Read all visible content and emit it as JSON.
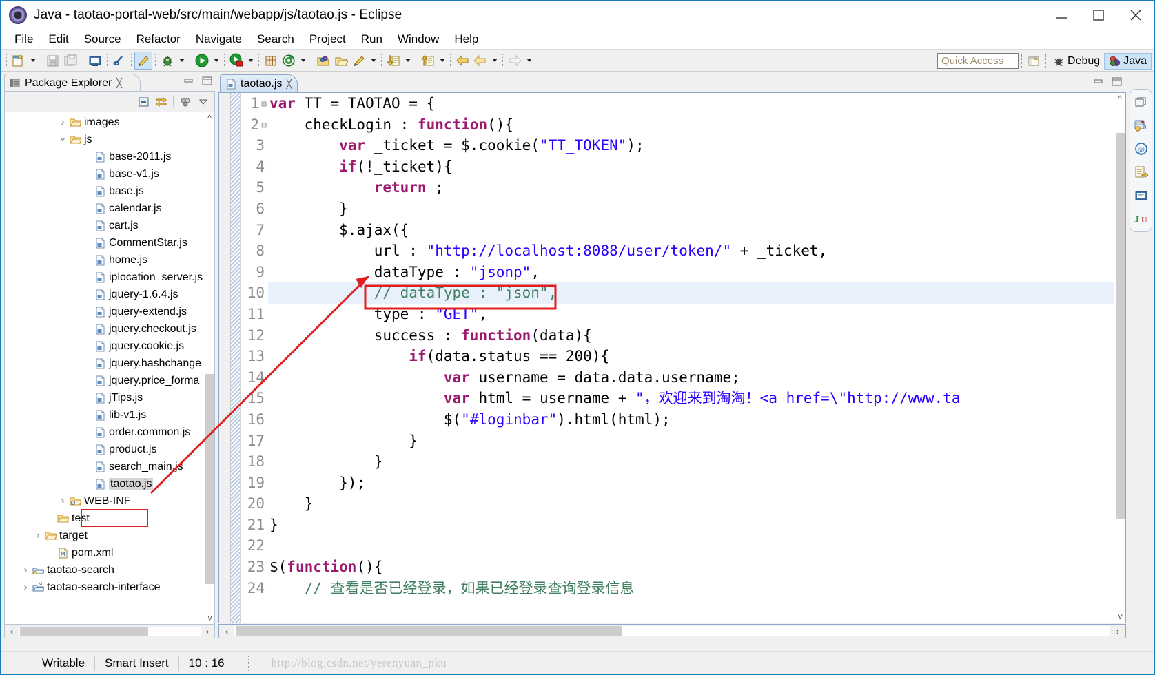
{
  "window": {
    "title": "Java - taotao-portal-web/src/main/webapp/js/taotao.js - Eclipse",
    "minimize": "─",
    "maximize": "□",
    "close": "✕"
  },
  "menubar": {
    "items": [
      "File",
      "Edit",
      "Source",
      "Refactor",
      "Navigate",
      "Search",
      "Project",
      "Run",
      "Window",
      "Help"
    ]
  },
  "toolbar": {
    "quick_access_placeholder": "Quick Access",
    "perspectives": [
      {
        "label": "Debug",
        "active": false
      },
      {
        "label": "Java",
        "active": true
      }
    ]
  },
  "package_explorer": {
    "tab_label": "Package Explorer",
    "tree": [
      {
        "label": "images",
        "indent": 4,
        "arrow": "closed",
        "icon": "folder",
        "sel": false
      },
      {
        "label": "js",
        "indent": 4,
        "arrow": "open",
        "icon": "folder",
        "sel": false
      },
      {
        "label": "base-2011.js",
        "indent": 6,
        "arrow": "none",
        "icon": "js-file",
        "sel": false
      },
      {
        "label": "base-v1.js",
        "indent": 6,
        "arrow": "none",
        "icon": "js-file",
        "sel": false
      },
      {
        "label": "base.js",
        "indent": 6,
        "arrow": "none",
        "icon": "js-file",
        "sel": false
      },
      {
        "label": "calendar.js",
        "indent": 6,
        "arrow": "none",
        "icon": "js-file",
        "sel": false
      },
      {
        "label": "cart.js",
        "indent": 6,
        "arrow": "none",
        "icon": "js-file",
        "sel": false
      },
      {
        "label": "CommentStar.js",
        "indent": 6,
        "arrow": "none",
        "icon": "js-file",
        "sel": false
      },
      {
        "label": "home.js",
        "indent": 6,
        "arrow": "none",
        "icon": "js-file",
        "sel": false
      },
      {
        "label": "iplocation_server.js",
        "indent": 6,
        "arrow": "none",
        "icon": "js-file",
        "sel": false
      },
      {
        "label": "jquery-1.6.4.js",
        "indent": 6,
        "arrow": "none",
        "icon": "js-file",
        "sel": false
      },
      {
        "label": "jquery-extend.js",
        "indent": 6,
        "arrow": "none",
        "icon": "js-file",
        "sel": false
      },
      {
        "label": "jquery.checkout.js",
        "indent": 6,
        "arrow": "none",
        "icon": "js-file",
        "sel": false
      },
      {
        "label": "jquery.cookie.js",
        "indent": 6,
        "arrow": "none",
        "icon": "js-file",
        "sel": false
      },
      {
        "label": "jquery.hashchange",
        "indent": 6,
        "arrow": "none",
        "icon": "js-file",
        "sel": false
      },
      {
        "label": "jquery.price_forma",
        "indent": 6,
        "arrow": "none",
        "icon": "js-file",
        "sel": false
      },
      {
        "label": "jTips.js",
        "indent": 6,
        "arrow": "none",
        "icon": "js-file",
        "sel": false
      },
      {
        "label": "lib-v1.js",
        "indent": 6,
        "arrow": "none",
        "icon": "js-file",
        "sel": false
      },
      {
        "label": "order.common.js",
        "indent": 6,
        "arrow": "none",
        "icon": "js-file",
        "sel": false
      },
      {
        "label": "product.js",
        "indent": 6,
        "arrow": "none",
        "icon": "js-file",
        "sel": false
      },
      {
        "label": "search_main.js",
        "indent": 6,
        "arrow": "none",
        "icon": "js-file",
        "sel": false
      },
      {
        "label": "taotao.js",
        "indent": 6,
        "arrow": "none",
        "icon": "js-file",
        "sel": true
      },
      {
        "label": "WEB-INF",
        "indent": 4,
        "arrow": "closed",
        "icon": "folder-web",
        "sel": false
      },
      {
        "label": "test",
        "indent": 3,
        "arrow": "none",
        "icon": "folder",
        "sel": false
      },
      {
        "label": "target",
        "indent": 2,
        "arrow": "closed",
        "icon": "folder",
        "sel": false
      },
      {
        "label": "pom.xml",
        "indent": 3,
        "arrow": "none",
        "icon": "xml-file",
        "sel": false
      },
      {
        "label": "taotao-search",
        "indent": 1,
        "arrow": "closed",
        "icon": "project-w",
        "sel": false
      },
      {
        "label": "taotao-search-interface",
        "indent": 1,
        "arrow": "closed",
        "icon": "project",
        "sel": false
      }
    ]
  },
  "editor": {
    "tab_label": "taotao.js",
    "tab_close": "☓",
    "first_line": 1,
    "highlight_line": 10,
    "lines": [
      {
        "n": 1,
        "fold": true,
        "tokens": [
          {
            "t": "var ",
            "c": "kw"
          },
          {
            "t": "TT = TAOTAO = {",
            "c": "pl"
          }
        ],
        "indent": 0
      },
      {
        "n": 2,
        "fold": true,
        "tokens": [
          {
            "t": "checkLogin : ",
            "c": "pl"
          },
          {
            "t": "function",
            "c": "kw"
          },
          {
            "t": "(){",
            "c": "pl"
          }
        ],
        "indent": 1
      },
      {
        "n": 3,
        "fold": false,
        "tokens": [
          {
            "t": "var ",
            "c": "kw"
          },
          {
            "t": "_ticket = $.cookie(",
            "c": "pl"
          },
          {
            "t": "\"TT_TOKEN\"",
            "c": "str"
          },
          {
            "t": ");",
            "c": "pl"
          }
        ],
        "indent": 2
      },
      {
        "n": 4,
        "fold": false,
        "tokens": [
          {
            "t": "if",
            "c": "kw"
          },
          {
            "t": "(!_ticket){",
            "c": "pl"
          }
        ],
        "indent": 2
      },
      {
        "n": 5,
        "fold": false,
        "tokens": [
          {
            "t": "return",
            "c": "kw"
          },
          {
            "t": " ;",
            "c": "pl"
          }
        ],
        "indent": 3
      },
      {
        "n": 6,
        "fold": false,
        "tokens": [
          {
            "t": "}",
            "c": "pl"
          }
        ],
        "indent": 2
      },
      {
        "n": 7,
        "fold": false,
        "tokens": [
          {
            "t": "$.ajax({",
            "c": "pl"
          }
        ],
        "indent": 2
      },
      {
        "n": 8,
        "fold": false,
        "tokens": [
          {
            "t": "url : ",
            "c": "pl"
          },
          {
            "t": "\"http://localhost:8088/user/token/\"",
            "c": "str"
          },
          {
            "t": " + _ticket,",
            "c": "pl"
          }
        ],
        "indent": 3
      },
      {
        "n": 9,
        "fold": false,
        "tokens": [
          {
            "t": "dataType : ",
            "c": "pl"
          },
          {
            "t": "\"jsonp\"",
            "c": "str"
          },
          {
            "t": ",",
            "c": "pl"
          }
        ],
        "indent": 3
      },
      {
        "n": 10,
        "fold": false,
        "tokens": [
          {
            "t": "// dataType : \"json\",",
            "c": "cm"
          }
        ],
        "indent": 3
      },
      {
        "n": 11,
        "fold": false,
        "tokens": [
          {
            "t": "type : ",
            "c": "pl"
          },
          {
            "t": "\"GET\"",
            "c": "str"
          },
          {
            "t": ",",
            "c": "pl"
          }
        ],
        "indent": 3
      },
      {
        "n": 12,
        "fold": false,
        "tokens": [
          {
            "t": "success : ",
            "c": "pl"
          },
          {
            "t": "function",
            "c": "kw"
          },
          {
            "t": "(data){",
            "c": "pl"
          }
        ],
        "indent": 3
      },
      {
        "n": 13,
        "fold": false,
        "tokens": [
          {
            "t": "if",
            "c": "kw"
          },
          {
            "t": "(data.status == 200){",
            "c": "pl"
          }
        ],
        "indent": 4
      },
      {
        "n": 14,
        "fold": false,
        "tokens": [
          {
            "t": "var ",
            "c": "kw"
          },
          {
            "t": "username = data.data.username;",
            "c": "pl"
          }
        ],
        "indent": 5
      },
      {
        "n": 15,
        "fold": false,
        "tokens": [
          {
            "t": "var ",
            "c": "kw"
          },
          {
            "t": "html = username + ",
            "c": "pl"
          },
          {
            "t": "\"，欢迎来到淘淘！<a href=\\\"http://www.ta",
            "c": "str"
          }
        ],
        "indent": 5
      },
      {
        "n": 16,
        "fold": false,
        "tokens": [
          {
            "t": "$(",
            "c": "pl"
          },
          {
            "t": "\"#loginbar\"",
            "c": "str"
          },
          {
            "t": ").html(html);",
            "c": "pl"
          }
        ],
        "indent": 5
      },
      {
        "n": 17,
        "fold": false,
        "tokens": [
          {
            "t": "}",
            "c": "pl"
          }
        ],
        "indent": 4
      },
      {
        "n": 18,
        "fold": false,
        "tokens": [
          {
            "t": "}",
            "c": "pl"
          }
        ],
        "indent": 3
      },
      {
        "n": 19,
        "fold": false,
        "tokens": [
          {
            "t": "});",
            "c": "pl"
          }
        ],
        "indent": 2
      },
      {
        "n": 20,
        "fold": false,
        "tokens": [
          {
            "t": "}",
            "c": "pl"
          }
        ],
        "indent": 1
      },
      {
        "n": 21,
        "fold": false,
        "tokens": [
          {
            "t": "}",
            "c": "pl"
          }
        ],
        "indent": 0
      },
      {
        "n": 22,
        "fold": false,
        "tokens": [],
        "indent": 0
      },
      {
        "n": 23,
        "fold": false,
        "tokens": [
          {
            "t": "$(",
            "c": "pl"
          },
          {
            "t": "function",
            "c": "kw"
          },
          {
            "t": "(){",
            "c": "pl"
          }
        ],
        "indent": 0
      },
      {
        "n": 24,
        "fold": false,
        "tokens": [
          {
            "t": "// 查看是否已经登录，如果已经登录查询登录信息",
            "c": "cm"
          }
        ],
        "indent": 1
      }
    ]
  },
  "statusbar": {
    "writable": "Writable",
    "insert_mode": "Smart Insert",
    "cursor_position": "10 : 16",
    "watermark": "http://blog.csdn.net/yerenyuan_pku"
  },
  "annotations": {
    "red_box_code_line": 9,
    "red_box_tree_item": "taotao.js",
    "arrow_color": "#e02020"
  }
}
